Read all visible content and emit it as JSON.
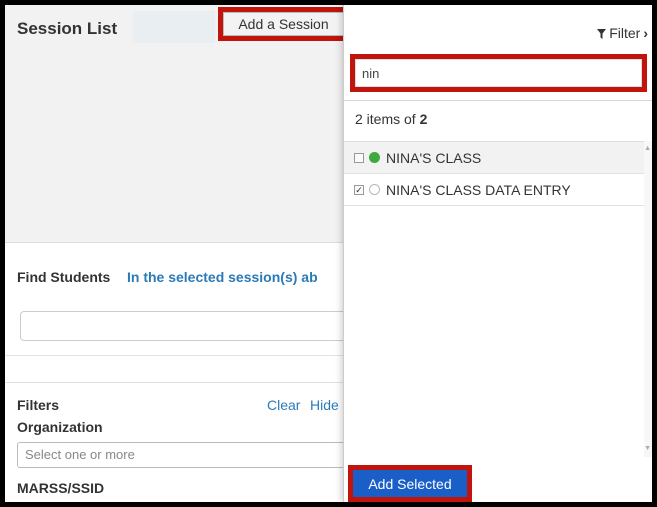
{
  "session_list": {
    "title": "Session List",
    "add_session_label": "Add a Session"
  },
  "find_students": {
    "label": "Find Students",
    "scope_text": "In the selected session(s) ab"
  },
  "filters": {
    "label": "Filters",
    "clear_label": "Clear",
    "hide_label": "Hide",
    "organization_label": "Organization",
    "organization_placeholder": "Select one or more",
    "marss_label": "MARSS/SSID"
  },
  "dropdown": {
    "filter_label": "Filter",
    "search_value": "nin",
    "count_prefix": "2 items of ",
    "count_total": "2",
    "items": [
      {
        "label": "NINA'S CLASS",
        "checked": false,
        "status": "active"
      },
      {
        "label": "NINA'S CLASS DATA ENTRY",
        "checked": true,
        "status": "inactive"
      }
    ],
    "add_selected_label": "Add Selected"
  },
  "colors": {
    "highlight": "#c0140c",
    "link": "#2a7ab8",
    "primary_button": "#1a5fc7",
    "status_active": "#3caa3c"
  }
}
